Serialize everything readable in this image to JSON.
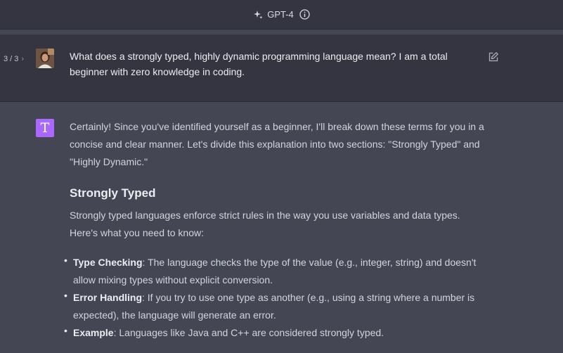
{
  "header": {
    "model_label": "GPT-4"
  },
  "user_message": {
    "pager": "3 / 3",
    "text": "What does a strongly typed, highly dynamic programming language mean? I am a total beginner with zero knowledge in coding."
  },
  "assistant": {
    "avatar_letter": "T",
    "intro": "Certainly! Since you've identified yourself as a beginner, I'll break down these terms for you in a concise and clear manner. Let's divide this explanation into two sections: \"Strongly Typed\" and \"Highly Dynamic.\"",
    "section_heading": "Strongly Typed",
    "section_intro": "Strongly typed languages enforce strict rules in the way you use variables and data types. Here's what you need to know:",
    "bullets": [
      {
        "term": "Type Checking",
        "text": ": The language checks the type of the value (e.g., integer, string) and doesn't allow mixing types without explicit conversion."
      },
      {
        "term": "Error Handling",
        "text": ": If you try to use one type as another (e.g., using a string where a number is expected), the language will generate an error."
      },
      {
        "term": "Example",
        "text": ": Languages like Java and C++ are considered strongly typed."
      }
    ]
  },
  "colors": {
    "page_bg": "#444654",
    "user_bg": "#343541",
    "assistant_avatar": "#ab68ff"
  },
  "icons": [
    "sparkle-icon",
    "info-icon",
    "chevron-right-icon",
    "edit-icon"
  ]
}
